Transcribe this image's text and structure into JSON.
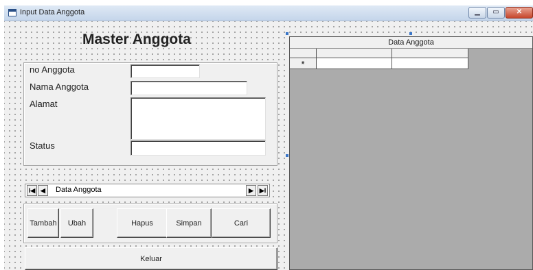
{
  "window": {
    "title": "Input Data Anggota",
    "minimize_icon": "minimize-icon",
    "maximize_icon": "maximize-icon",
    "close_icon": "close-icon"
  },
  "form": {
    "caption": "Master Anggota",
    "fields": [
      {
        "label": "no Anggota",
        "value": ""
      },
      {
        "label": "Nama Anggota",
        "value": ""
      },
      {
        "label": "Alamat",
        "value": ""
      },
      {
        "label": "Status",
        "value": ""
      }
    ],
    "navigator": {
      "caption": "Data Anggota",
      "first": "I◀",
      "prev": "◀",
      "next": "▶",
      "last": "▶I"
    },
    "buttons": {
      "tambah": "Tambah",
      "ubah": "Ubah",
      "hapus": "Hapus",
      "simpan": "Simpan",
      "cari": "Cari",
      "keluar": "Keluar"
    }
  },
  "grid": {
    "caption": "Data Anggota",
    "new_row_marker": "*"
  }
}
